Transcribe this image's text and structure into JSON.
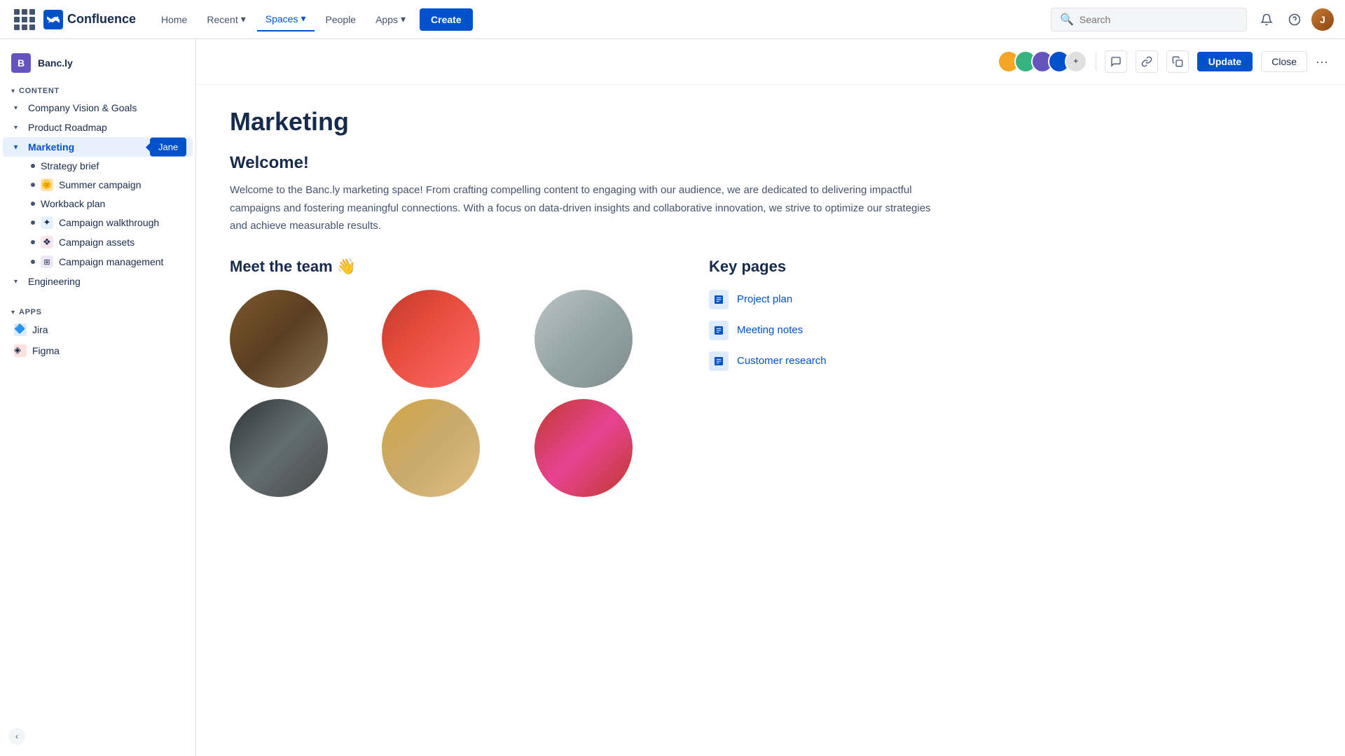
{
  "nav": {
    "home": "Home",
    "recent": "Recent",
    "spaces": "Spaces",
    "people": "People",
    "apps": "Apps",
    "create": "Create",
    "search_placeholder": "Search"
  },
  "sidebar": {
    "space_name": "Banc.ly",
    "content_label": "CONTENT",
    "apps_label": "APPS",
    "items": [
      {
        "id": "company-vision",
        "label": "Company Vision & Goals",
        "indent": 1
      },
      {
        "id": "product-roadmap",
        "label": "Product Roadmap",
        "indent": 1
      },
      {
        "id": "marketing",
        "label": "Marketing",
        "indent": 1,
        "active": true
      },
      {
        "id": "strategy-brief",
        "label": "Strategy brief",
        "indent": 2
      },
      {
        "id": "summer-campaign",
        "label": "Summer campaign",
        "indent": 2
      },
      {
        "id": "workback-plan",
        "label": "Workback plan",
        "indent": 2,
        "no-bullet": true
      },
      {
        "id": "campaign-walkthrough",
        "label": "Campaign walkthrough",
        "indent": 2
      },
      {
        "id": "campaign-assets",
        "label": "Campaign assets",
        "indent": 2
      },
      {
        "id": "campaign-management",
        "label": "Campaign management",
        "indent": 2
      },
      {
        "id": "engineering",
        "label": "Engineering",
        "indent": 1
      }
    ],
    "apps": [
      {
        "id": "jira",
        "label": "Jira"
      },
      {
        "id": "figma",
        "label": "Figma"
      }
    ],
    "tooltip": "Jane"
  },
  "content_header": {
    "update_btn": "Update",
    "close_btn": "Close"
  },
  "page": {
    "title": "Marketing",
    "welcome_heading": "Welcome!",
    "welcome_text": "Welcome to the Banc.ly marketing space! From crafting compelling content to engaging with our audience, we are dedicated to delivering impactful campaigns and fostering meaningful connections. With a focus on data-driven insights and collaborative innovation, we strive to optimize our strategies and achieve measurable results.",
    "team_heading": "Meet the team 👋",
    "key_pages_heading": "Key pages",
    "key_pages": [
      {
        "id": "project-plan",
        "label": "Project plan"
      },
      {
        "id": "meeting-notes",
        "label": "Meeting notes"
      },
      {
        "id": "customer-research",
        "label": "Customer research"
      }
    ]
  }
}
